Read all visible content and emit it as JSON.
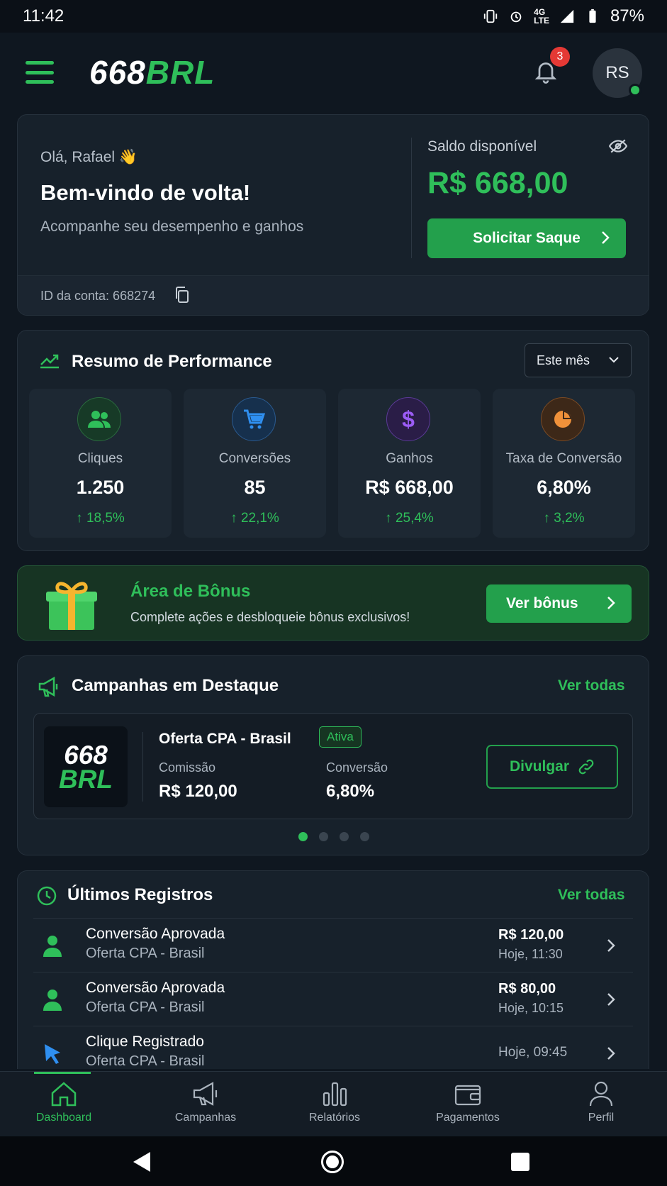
{
  "status_bar": {
    "time": "11:42",
    "battery": "87%",
    "network": "4G LTE"
  },
  "header": {
    "logo_part1": "668",
    "logo_part2": "BRL",
    "notification_count": "3",
    "avatar_initials": "RS"
  },
  "welcome": {
    "greeting": "Olá, Rafael 👋",
    "title": "Bem-vindo de volta!",
    "subtitle": "Acompanhe seu desempenho e ganhos",
    "balance_label": "Saldo disponível",
    "balance_value": "R$ 668,00",
    "withdraw_button": "Solicitar Saque",
    "account_id": "ID da conta: 668274"
  },
  "performance": {
    "title": "Resumo de Performance",
    "period": "Este mês",
    "stats": [
      {
        "label": "Cliques",
        "value": "1.250",
        "change": "↑ 18,5%",
        "icon": "users-icon",
        "color": "#2fbf5a"
      },
      {
        "label": "Conversões",
        "value": "85",
        "change": "↑ 22,1%",
        "icon": "cart-icon",
        "color": "#2f8ff0"
      },
      {
        "label": "Ganhos",
        "value": "R$ 668,00",
        "change": "↑ 25,4%",
        "icon": "dollar-icon",
        "color": "#9b5cf5"
      },
      {
        "label": "Taxa de Conversão",
        "value": "6,80%",
        "change": "↑ 3,2%",
        "icon": "pie-chart-icon",
        "color": "#f0913a"
      }
    ]
  },
  "bonus": {
    "title": "Área de Bônus",
    "subtitle": "Complete ações e desbloqueie bônus exclusivos!",
    "button": "Ver bônus"
  },
  "campaigns": {
    "title": "Campanhas em Destaque",
    "see_all": "Ver todas",
    "offer": {
      "logo_part1": "668",
      "logo_part2": "BRL",
      "name": "Oferta CPA - Brasil",
      "status": "Ativa",
      "commission_label": "Comissão",
      "commission_value": "R$ 120,00",
      "conversion_label": "Conversão",
      "conversion_value": "6,80%",
      "button": "Divulgar"
    }
  },
  "records": {
    "title": "Últimos Registros",
    "see_all": "Ver todas",
    "items": [
      {
        "title": "Conversão Aprovada",
        "subtitle": "Oferta CPA - Brasil",
        "amount": "R$ 120,00",
        "time": "Hoje, 11:30",
        "icon": "user-icon"
      },
      {
        "title": "Conversão Aprovada",
        "subtitle": "Oferta CPA - Brasil",
        "amount": "R$ 80,00",
        "time": "Hoje, 10:15",
        "icon": "user-icon"
      },
      {
        "title": "Clique Registrado",
        "subtitle": "Oferta CPA - Brasil",
        "amount": "",
        "time": "Hoje, 09:45",
        "icon": "cursor-icon"
      }
    ]
  },
  "bottom_nav": {
    "items": [
      {
        "label": "Dashboard",
        "icon": "home-icon"
      },
      {
        "label": "Campanhas",
        "icon": "megaphone-icon"
      },
      {
        "label": "Relatórios",
        "icon": "bar-chart-icon"
      },
      {
        "label": "Pagamentos",
        "icon": "wallet-icon"
      },
      {
        "label": "Perfil",
        "icon": "person-icon"
      }
    ]
  },
  "colors": {
    "accent": "#2fbf5a",
    "background": "#0f1720",
    "card": "#17212b"
  }
}
